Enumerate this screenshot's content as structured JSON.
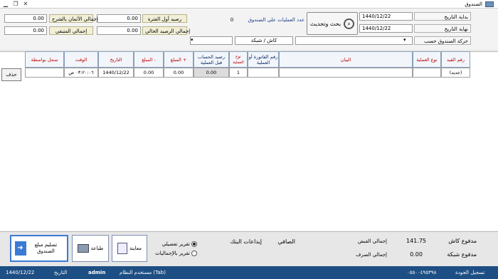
{
  "window": {
    "title": "الصندوق"
  },
  "filters": {
    "from_date_label": "بداية التاريخ",
    "from_date": "1440/12/22",
    "to_date_label": "نهاية التاريخ",
    "to_date": "1440/12/22",
    "account_label": "حركة الصندوق حسب",
    "search_label": "بحث وتحديث",
    "ops_count_label": "عدد العمليات على الصندوق",
    "ops_count": "0",
    "payment_label": "كاش / شبكة",
    "opening_balance_label": "رصيد أول الفترة",
    "opening_balance": "0.00",
    "current_balance_label": "إجمالي الرصيد الحالي",
    "current_balance": "0.00",
    "total_due_label": "إجمالي الأثمان بالشرح",
    "total_due": "0.00",
    "total_remaining_label": "إجمالي المتبقي",
    "total_remaining": "0.00"
  },
  "table": {
    "headers": {
      "entry_no": "رقم القيد",
      "op_type": "نوع العملية",
      "statement": "البيان",
      "invoice_no": "رقم الفاتورة أو العملية",
      "op_no": "نوع العملية",
      "balance_before": "رصيد الحساب قبل العملية",
      "amount_plus": "المبلغ +",
      "amount_minus": "المبلغ -",
      "date": "التاريخ",
      "time": "الوقت",
      "recorded_by": "سجل بواسطة"
    },
    "row": {
      "entry_no": "(جديد)",
      "op_type": "",
      "statement": "",
      "invoice_no": "",
      "op_no": "1",
      "balance_before": "0.00",
      "amount_plus": "0.00",
      "amount_minus": "0.00",
      "date": "1440/12/22",
      "time": "٠٣:٢٠:٠٦ ص",
      "recorded_by": ""
    },
    "delete_label": "حذف"
  },
  "bottom": {
    "cash_paid_label": "مدفوع كاش",
    "cash_paid": "141.75",
    "network_paid_label": "مدفوع شبكة",
    "network_paid": "0.00",
    "total_receipts_label": "إجمالي القبض",
    "total_receipts": "",
    "total_payments_label": "إجمالي الصرف",
    "total_payments": "",
    "net_label": "الصافي",
    "bank_deposits_label": "إيداعات البنك",
    "report_detailed_label": "تقرير تفصيلي",
    "report_totals_label": "تقرير بالإجماليات",
    "edit_label": "معاينة",
    "print_label": "طباعة",
    "handover_label": "تسليم مبلغ الصندوق"
  },
  "statusbar": {
    "date": "1440/12/22",
    "date_label": "التاريخ",
    "user": "admin",
    "user_label": "مستخدم النظام (Tab)",
    "phone": "٠٥٥٠٠٤٩٥٣٩٨",
    "org": "تسجيل الجودة"
  }
}
